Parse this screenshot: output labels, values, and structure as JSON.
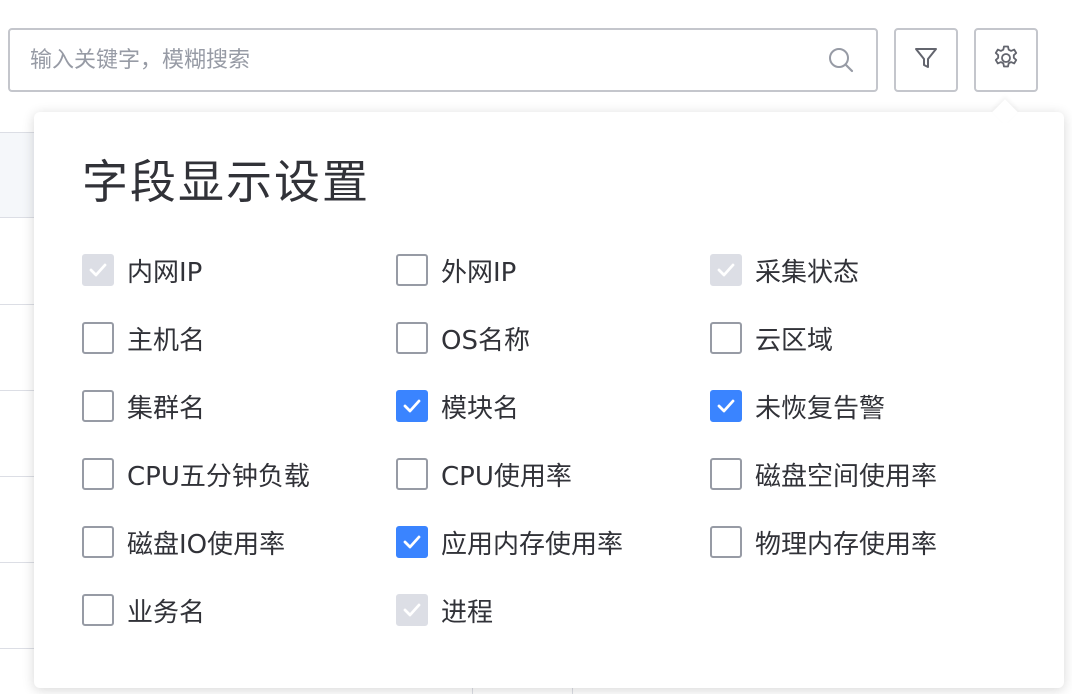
{
  "search": {
    "placeholder": "输入关键字，模糊搜索"
  },
  "icons": {
    "search": "search-icon",
    "filter": "funnel-icon",
    "settings": "gear-icon",
    "check": "checkmark-icon"
  },
  "colors": {
    "accent": "#3a84ff",
    "disabled": "#dcdee5",
    "border": "#c4c6cc",
    "text": "#313238",
    "placeholder": "#979ba5"
  },
  "popover": {
    "title": "字段显示设置",
    "options": [
      {
        "label": "内网IP",
        "state": "disabled"
      },
      {
        "label": "外网IP",
        "state": "unchecked"
      },
      {
        "label": "采集状态",
        "state": "disabled"
      },
      {
        "label": "主机名",
        "state": "unchecked"
      },
      {
        "label": "OS名称",
        "state": "unchecked"
      },
      {
        "label": "云区域",
        "state": "unchecked"
      },
      {
        "label": "集群名",
        "state": "unchecked"
      },
      {
        "label": "模块名",
        "state": "checked"
      },
      {
        "label": "未恢复告警",
        "state": "checked"
      },
      {
        "label": "CPU五分钟负载",
        "state": "unchecked"
      },
      {
        "label": "CPU使用率",
        "state": "unchecked"
      },
      {
        "label": "磁盘空间使用率",
        "state": "unchecked"
      },
      {
        "label": "磁盘IO使用率",
        "state": "unchecked"
      },
      {
        "label": "应用内存使用率",
        "state": "checked"
      },
      {
        "label": "物理内存使用率",
        "state": "unchecked"
      },
      {
        "label": "业务名",
        "state": "unchecked"
      },
      {
        "label": "进程",
        "state": "disabled"
      }
    ]
  }
}
